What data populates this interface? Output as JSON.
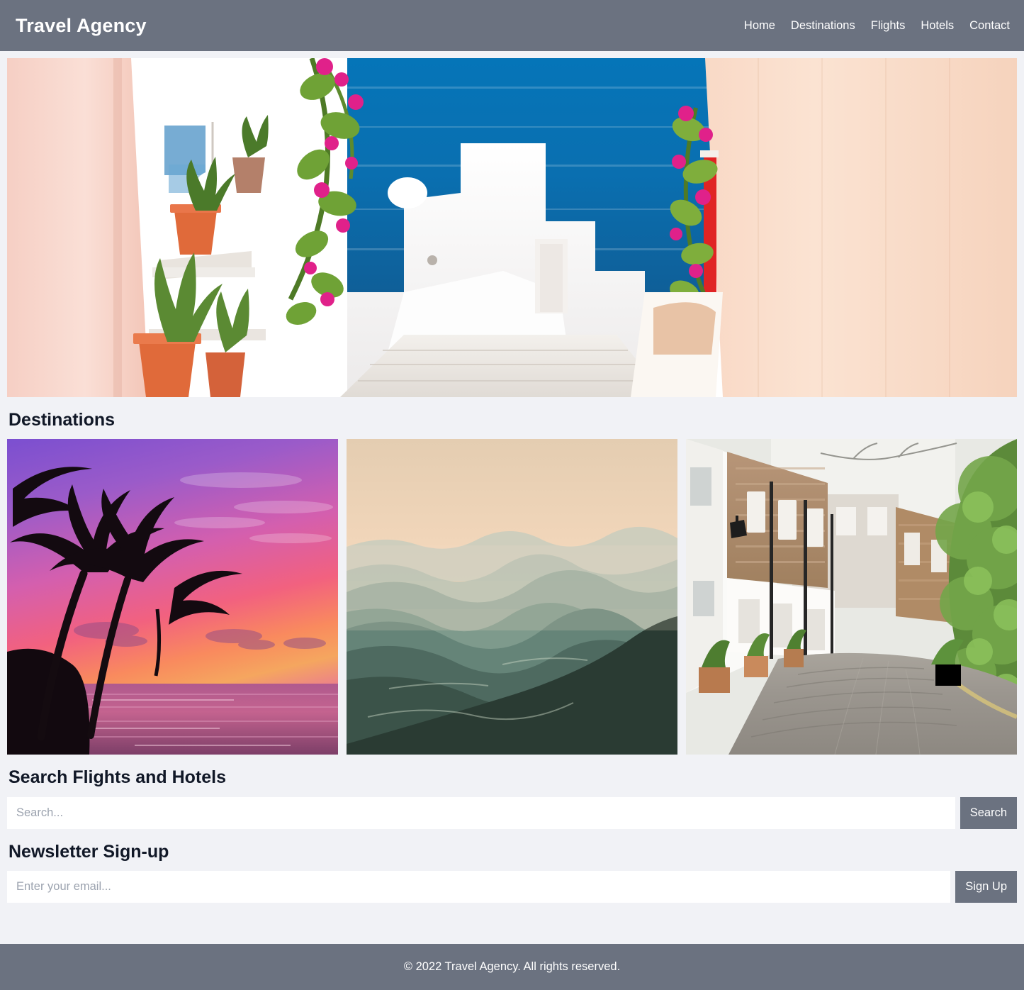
{
  "header": {
    "brand": "Travel Agency",
    "nav": [
      {
        "label": "Home"
      },
      {
        "label": "Destinations"
      },
      {
        "label": "Flights"
      },
      {
        "label": "Hotels"
      },
      {
        "label": "Contact"
      }
    ]
  },
  "hero": {
    "alt": "Santorini whitewashed alleyway overlooking the deep blue Aegean sea with bougainvillea and terracotta pots"
  },
  "destinations": {
    "title": "Destinations",
    "cards": [
      {
        "alt": "Tropical beach at sunset with silhouetted palm trees over a pink and purple sky"
      },
      {
        "alt": "Layered misty mountain ridges at dawn under a peach sky"
      },
      {
        "alt": "Cobblestone European mews street lined with white townhouses and greenery"
      }
    ]
  },
  "search": {
    "title": "Search Flights and Hotels",
    "placeholder": "Search...",
    "value": "",
    "button_label": "Search"
  },
  "newsletter": {
    "title": "Newsletter Sign-up",
    "placeholder": "Enter your email...",
    "value": "",
    "button_label": "Sign Up"
  },
  "footer": {
    "text": "© 2022 Travel Agency. All rights reserved."
  },
  "colors": {
    "brand_gray": "#6b7280",
    "page_background": "#f1f2f6",
    "text_dark": "#111827",
    "placeholder": "#9ca3af",
    "white": "#ffffff"
  }
}
